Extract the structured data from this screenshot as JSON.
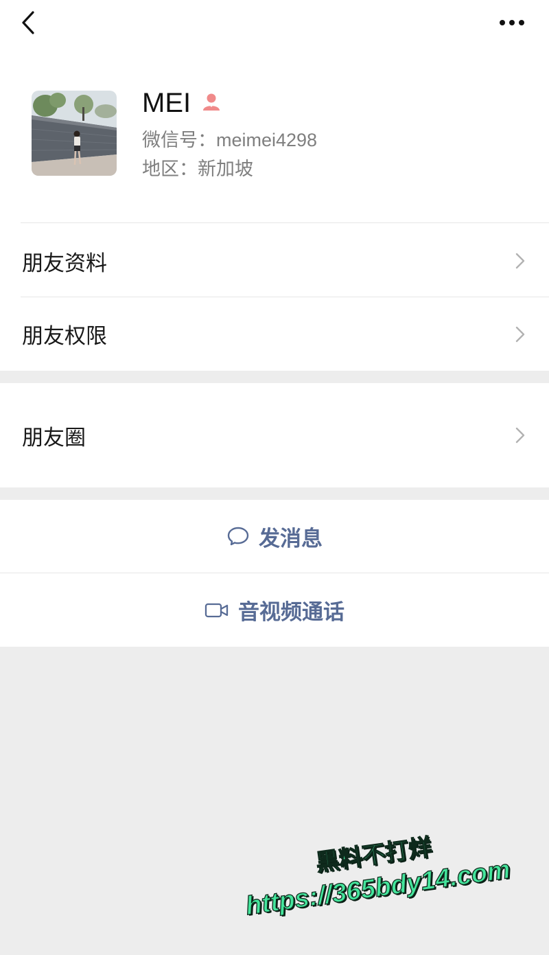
{
  "header": {
    "back_icon": "chevron-left-icon",
    "more_icon": "more-horizontal-icon"
  },
  "profile": {
    "name": "MEI",
    "gender_icon": "female-icon",
    "wechat_id": "微信号：meimei4298",
    "region": "地区：新加坡"
  },
  "menu": {
    "items": [
      {
        "label": "朋友资料",
        "icon": "chevron-right-icon"
      },
      {
        "label": "朋友权限",
        "icon": "chevron-right-icon"
      }
    ]
  },
  "moments": {
    "label": "朋友圈",
    "icon": "chevron-right-icon"
  },
  "actions": [
    {
      "label": "发消息",
      "icon": "chat-bubble-icon"
    },
    {
      "label": "音视频通话",
      "icon": "video-call-icon"
    }
  ],
  "watermark": {
    "title": "黑料不打烊",
    "url": "https://365bdy14.com"
  },
  "colors": {
    "background": "#ededed",
    "panel": "#ffffff",
    "accent": "#576b95",
    "secondary_text": "#7f7f7f",
    "chevron": "#b2b2b2",
    "female_icon": "#f08a8a",
    "watermark": "#44e59c"
  }
}
